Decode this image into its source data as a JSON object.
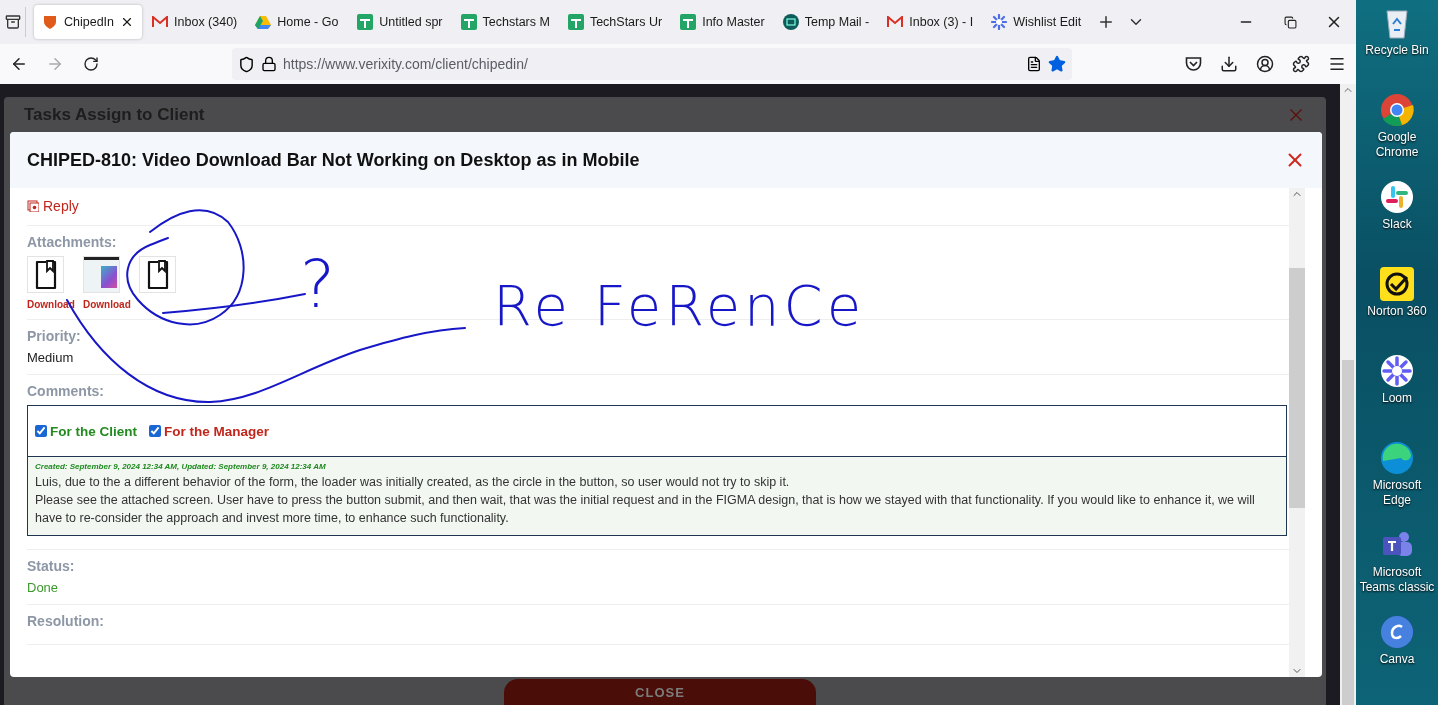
{
  "browser": {
    "tabs": [
      {
        "label": "ChipedIn",
        "kind": "shield",
        "selected": true
      },
      {
        "label": "Inbox (340)",
        "kind": "mail",
        "selected": false
      },
      {
        "label": "Home - Go",
        "kind": "drive",
        "selected": false
      },
      {
        "label": "Untitled spr",
        "kind": "sheet",
        "selected": false
      },
      {
        "label": "Techstars M",
        "kind": "sheet",
        "selected": false
      },
      {
        "label": "TechStars Ur",
        "kind": "sheet",
        "selected": false
      },
      {
        "label": "Info Master",
        "kind": "sheet",
        "selected": false
      },
      {
        "label": "Temp Mail -",
        "kind": "tempmail",
        "selected": false
      },
      {
        "label": "Inbox (3) - I",
        "kind": "mail",
        "selected": false
      },
      {
        "label": "Wishlist Edit",
        "kind": "flower",
        "selected": false
      }
    ],
    "address": "https://www.verixity.com/client/chipedin/",
    "bookmarked": true
  },
  "background_page": {
    "title": "Tasks Assign to Client",
    "close_button": "CLOSE"
  },
  "modal": {
    "title": "CHIPED-810: Video Download Bar Not Working on Desktop as in Mobile",
    "reply_link": "Reply",
    "attachments_label": "Attachments:",
    "attachments": [
      {
        "kind": "file",
        "download": "Download"
      },
      {
        "kind": "image",
        "download": "Download"
      },
      {
        "kind": "file"
      }
    ],
    "priority_label": "Priority:",
    "priority": "Medium",
    "comments_label": "Comments:",
    "filters": [
      {
        "label": "For the Client",
        "checked": true,
        "color": "#238a1f"
      },
      {
        "label": "For the Manager",
        "checked": true,
        "color": "#c0261c"
      }
    ],
    "comments": [
      {
        "meta": "Created: September 9, 2024 12:34 AM, Updated: September 9, 2024 12:34 AM",
        "paragraphs": [
          "Luis, due to the a different behavior of the form, the loader was initially created, as the circle in the button, so user would not try to skip it.",
          "Please see the attached screen. User have to press the button submit, and then wait, that was the initial request and in the FIGMA design, that is how we stayed with that functionality. If you would like to enhance it, we will have to re-consider the approach and invest more time, to enhance such functionality."
        ]
      }
    ],
    "status_label": "Status:",
    "status": "Done",
    "resolution_label": "Resolution:"
  },
  "annotation": {
    "question_mark": "?",
    "word": "Re FeRenCe"
  },
  "desktop": {
    "icons": [
      {
        "label": "Recycle Bin",
        "kind": "recycle"
      },
      {
        "label": "Google Chrome",
        "kind": "chrome"
      },
      {
        "label": "Slack",
        "kind": "slack"
      },
      {
        "label": "Norton 360",
        "kind": "norton"
      },
      {
        "label": "Loom",
        "kind": "loom"
      },
      {
        "label": "Microsoft Edge",
        "kind": "edge"
      },
      {
        "label": "Microsoft Teams classic",
        "kind": "teams"
      },
      {
        "label": "Canva",
        "kind": "canva"
      }
    ]
  }
}
